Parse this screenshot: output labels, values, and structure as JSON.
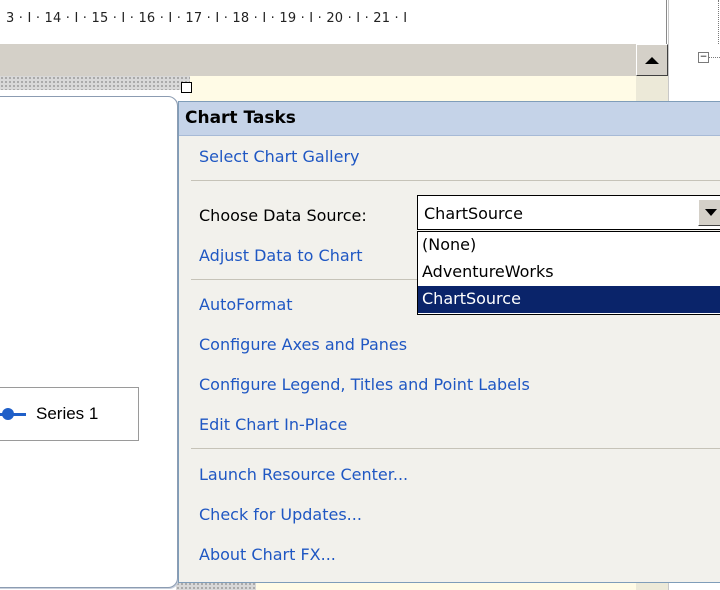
{
  "ruler": {
    "text": "3 · I · 14 · I · 15 · I · 16 · I · 17 · I · 18 · I · 19 · I · 20 · I · 21 · I"
  },
  "tree": {
    "toggle": "−"
  },
  "chart": {
    "legend_label": "Series 1",
    "series_color": "#1f5fc8"
  },
  "chart_tasks": {
    "title": "Chart Tasks",
    "select_gallery": "Select Chart Gallery",
    "data_source_label": "Choose Data Source:",
    "data_source_value": "ChartSource",
    "data_source_options": [
      "(None)",
      "AdventureWorks",
      "ChartSource"
    ],
    "adjust_data": "Adjust Data to Chart",
    "autoformat": "AutoFormat",
    "configure_axes": "Configure Axes and Panes",
    "configure_legend": "Configure Legend, Titles and Point Labels",
    "edit_in_place": "Edit Chart In-Place",
    "launch_resource": "Launch Resource Center...",
    "check_updates": "Check for Updates...",
    "about": "About Chart FX..."
  },
  "colors": {
    "header_bg": "#c5d3e8",
    "link": "#1f57c3",
    "selection": "#0a246a"
  }
}
